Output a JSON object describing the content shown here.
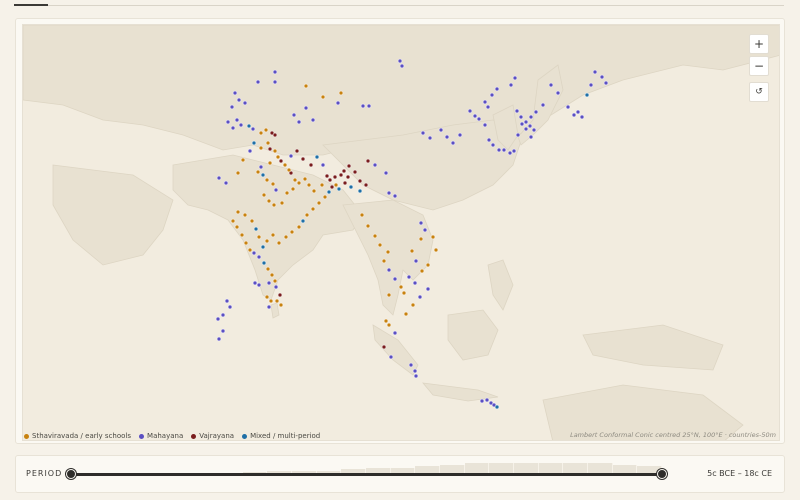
{
  "map": {
    "zoom_in_label": "+",
    "zoom_out_label": "−",
    "reset_label": "↺",
    "projection_note": "Lambert Conformal Conic centred 25°N, 100°E · countries-50m"
  },
  "legend": [
    {
      "label": "Sthaviravada / early schools",
      "color": "#c8820f"
    },
    {
      "label": "Mahayana",
      "color": "#5b4fc2"
    },
    {
      "label": "Vajrayana",
      "color": "#7a1d1d"
    },
    {
      "label": "Mixed / multi-period",
      "color": "#1f6fa6"
    }
  ],
  "period": {
    "label": "PERIOD",
    "range_text": "5c BCE – 18c CE"
  }
}
